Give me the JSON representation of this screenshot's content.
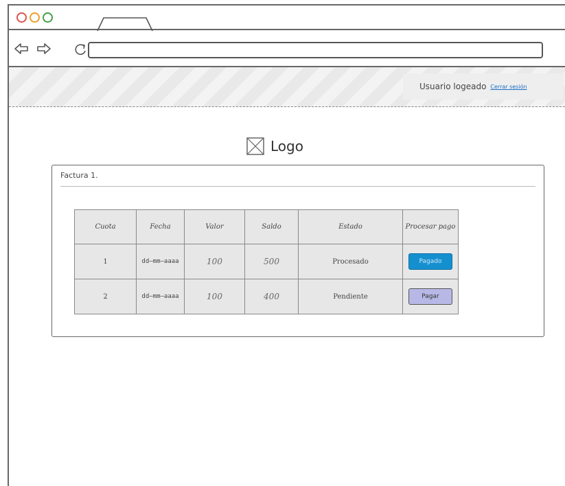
{
  "browser": {
    "window_buttons": [
      "close",
      "minimize",
      "maximize"
    ],
    "address": ""
  },
  "header": {
    "user_label": "Usuario logeado",
    "logout_label": "Cerrar sesión"
  },
  "logo": {
    "text": "Logo"
  },
  "invoice": {
    "title": "Factura 1.",
    "columns": [
      "Cuota",
      "Fecha",
      "Valor",
      "Saldo",
      "Estado",
      "Procesar pago"
    ],
    "rows": [
      {
        "cuota": "1",
        "fecha": "dd—mm—aaaa",
        "valor": "100",
        "saldo": "500",
        "estado": "Procesado",
        "action": "Pagado"
      },
      {
        "cuota": "2",
        "fecha": "dd—mm—aaaa",
        "valor": "100",
        "saldo": "400",
        "estado": "Pendiente",
        "action": "Pagar"
      }
    ]
  },
  "colors": {
    "paid_button": "#1590cf",
    "pay_button": "#b8b8e6",
    "link": "#1a6fc4"
  }
}
